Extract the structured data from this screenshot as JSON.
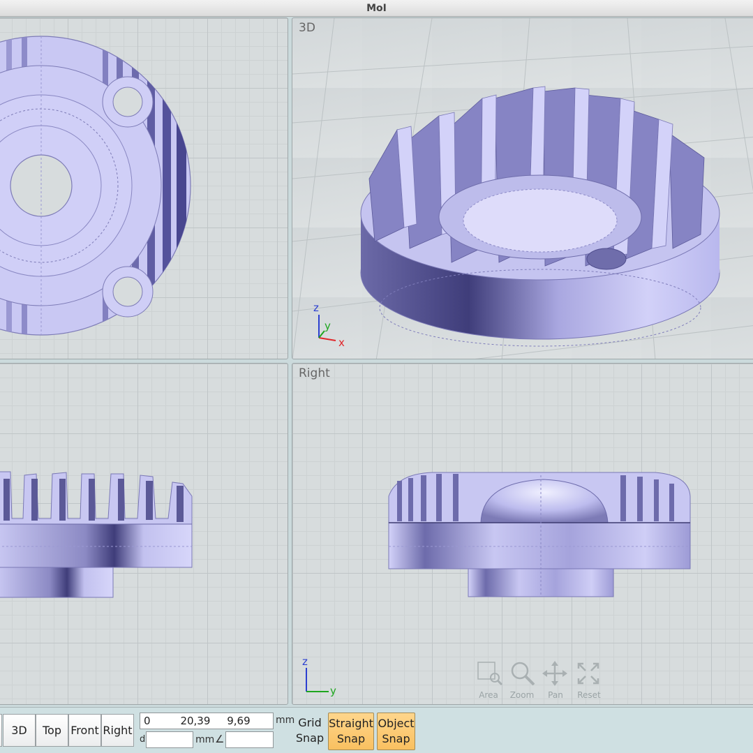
{
  "window": {
    "title": "MoI"
  },
  "viewports": {
    "top": {
      "label": ""
    },
    "3d": {
      "label": "3D"
    },
    "front": {
      "label": ""
    },
    "right": {
      "label": "Right"
    }
  },
  "axes": {
    "3d": {
      "z": "z",
      "y": "y",
      "x": "x"
    },
    "right": {
      "z": "z",
      "y": "y"
    }
  },
  "axis_colors": {
    "x": "#e0262a",
    "y": "#1ea61e",
    "z": "#2b3fd0"
  },
  "view_controls": [
    {
      "label": "Area",
      "icon": "area-zoom-icon"
    },
    {
      "label": "Zoom",
      "icon": "magnifier-icon"
    },
    {
      "label": "Pan",
      "icon": "pan-arrows-icon"
    },
    {
      "label": "Reset",
      "icon": "reset-expand-icon"
    }
  ],
  "toolbar": {
    "view_buttons": [
      "3D",
      "Top",
      "Front",
      "Right"
    ],
    "coords_value": "0         20,39     9,69",
    "coords_unit": "mm",
    "distance_label": "d",
    "distance_unit": "mm",
    "angle_symbol": "∠",
    "grid_snap": [
      "Grid",
      "Snap"
    ],
    "straight_snap": [
      "Straight",
      "Snap"
    ],
    "object_snap": [
      "Object",
      "Snap"
    ]
  },
  "colors": {
    "model": "#c8c8f2",
    "snap_active": "#fcc96e",
    "background": "#d7dcdd"
  }
}
